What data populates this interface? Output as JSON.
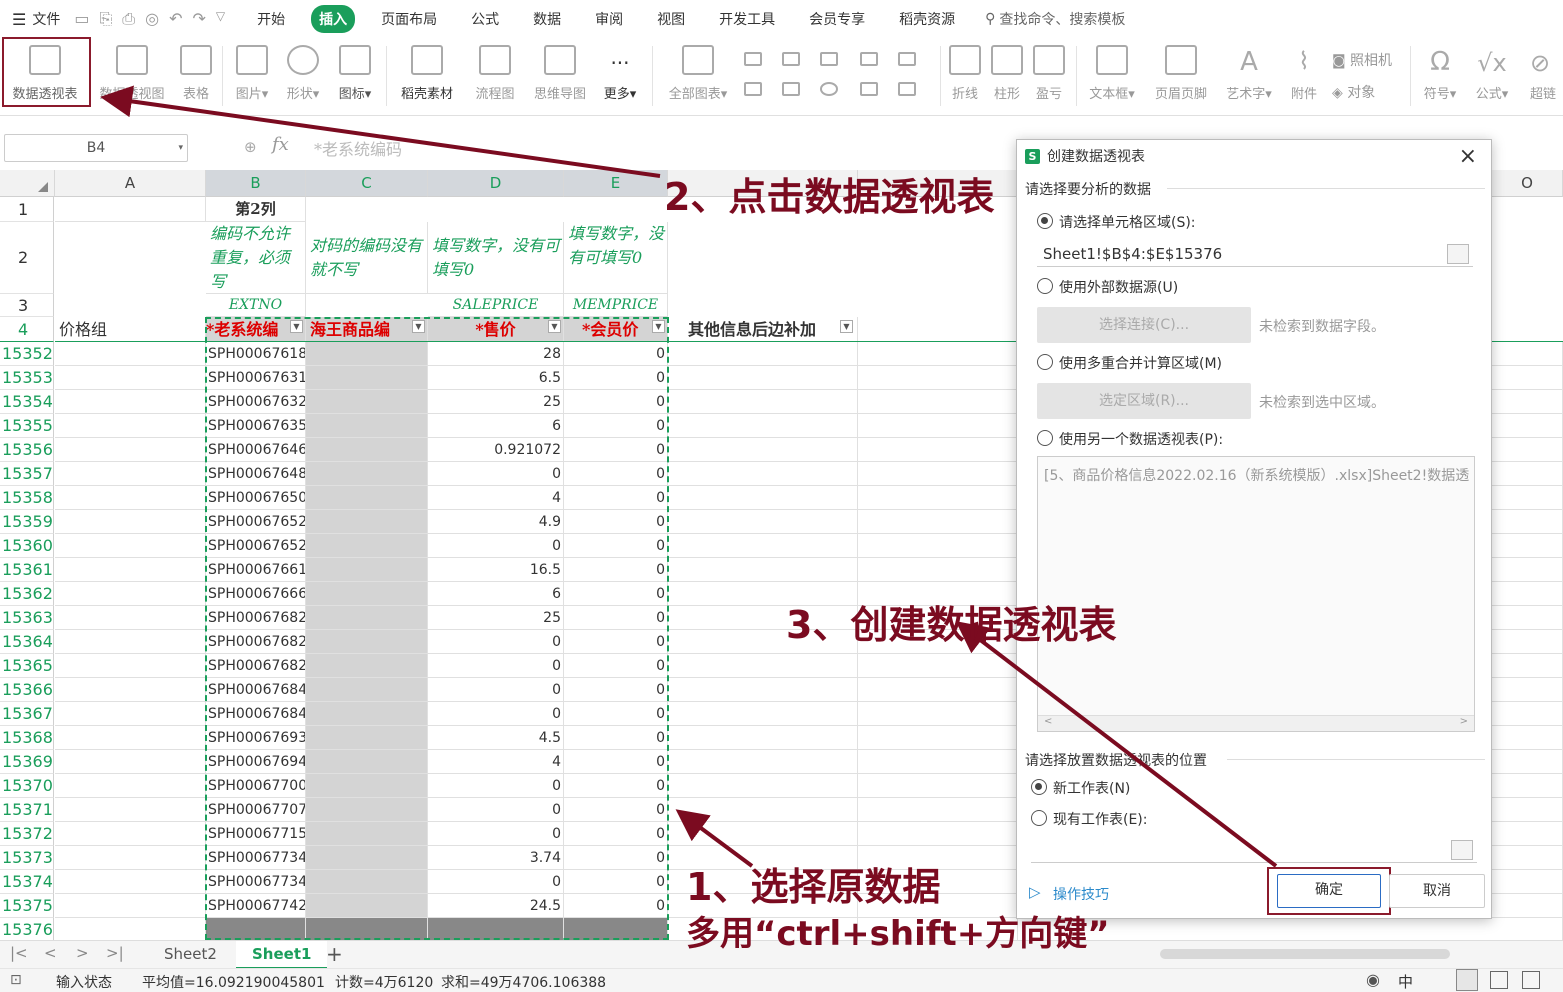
{
  "menubar": {
    "file_label": "文件",
    "items": [
      "开始",
      "插入",
      "页面布局",
      "公式",
      "数据",
      "审阅",
      "视图",
      "开发工具",
      "会员专享",
      "稻壳资源"
    ],
    "active": "插入",
    "search_label": "查找命令、搜索模板"
  },
  "ribbon": {
    "pivot_table": "数据透视表",
    "pivot_chart": "数据透视图",
    "table": "表格",
    "picture": "图片",
    "shape": "形状",
    "icon": "图标",
    "docer": "稻壳素材",
    "flowchart": "流程图",
    "mindmap": "思维导图",
    "more": "更多",
    "all_charts": "全部图表",
    "line": "折线",
    "column": "柱形",
    "winloss": "盈亏",
    "textbox": "文本框",
    "header_footer": "页眉页脚",
    "wordart": "艺术字",
    "attachment": "附件",
    "camera": "照相机",
    "object": "对象",
    "symbol": "符号",
    "formula": "公式",
    "hyperlink": "超链"
  },
  "formula_bar": {
    "name_box": "B4",
    "fx": "fx",
    "content": "*老系统编码"
  },
  "grid": {
    "columns": [
      "A",
      "B",
      "C",
      "D",
      "E",
      "O"
    ],
    "row_numbers_top": [
      "1",
      "2",
      "3",
      "4"
    ],
    "b1": "第2列",
    "b2": "编码不允许重复，必须写",
    "c2": "对码的编码没有就不写",
    "d2": "填写数字，没有可填写0",
    "e2": "填写数字，没有可填写0",
    "b3": "EXTNO",
    "d3": "SALEPRICE",
    "e3": "MEMPRICE",
    "a4": "价格组",
    "b4": "*老系统编",
    "c4": "海王商品编",
    "d4": "*售价",
    "e4": "*会员价",
    "f4": "其他信息后边补加",
    "rows": [
      {
        "n": "15352",
        "code": "SPH00067618",
        "price": "28",
        "mem": "0"
      },
      {
        "n": "15353",
        "code": "SPH00067631",
        "price": "6.5",
        "mem": "0"
      },
      {
        "n": "15354",
        "code": "SPH00067632",
        "price": "25",
        "mem": "0"
      },
      {
        "n": "15355",
        "code": "SPH00067635",
        "price": "6",
        "mem": "0"
      },
      {
        "n": "15356",
        "code": "SPH00067646",
        "price": "0.921072",
        "mem": "0"
      },
      {
        "n": "15357",
        "code": "SPH00067648",
        "price": "0",
        "mem": "0"
      },
      {
        "n": "15358",
        "code": "SPH00067650",
        "price": "4",
        "mem": "0"
      },
      {
        "n": "15359",
        "code": "SPH00067652",
        "price": "4.9",
        "mem": "0"
      },
      {
        "n": "15360",
        "code": "SPH00067652",
        "price": "0",
        "mem": "0"
      },
      {
        "n": "15361",
        "code": "SPH00067661",
        "price": "16.5",
        "mem": "0"
      },
      {
        "n": "15362",
        "code": "SPH00067666",
        "price": "6",
        "mem": "0"
      },
      {
        "n": "15363",
        "code": "SPH00067682",
        "price": "25",
        "mem": "0"
      },
      {
        "n": "15364",
        "code": "SPH00067682",
        "price": "0",
        "mem": "0"
      },
      {
        "n": "15365",
        "code": "SPH00067682",
        "price": "0",
        "mem": "0"
      },
      {
        "n": "15366",
        "code": "SPH00067684",
        "price": "0",
        "mem": "0"
      },
      {
        "n": "15367",
        "code": "SPH00067684",
        "price": "0",
        "mem": "0"
      },
      {
        "n": "15368",
        "code": "SPH00067693",
        "price": "4.5",
        "mem": "0"
      },
      {
        "n": "15369",
        "code": "SPH00067694",
        "price": "4",
        "mem": "0"
      },
      {
        "n": "15370",
        "code": "SPH00067700",
        "price": "0",
        "mem": "0"
      },
      {
        "n": "15371",
        "code": "SPH00067707",
        "price": "0",
        "mem": "0"
      },
      {
        "n": "15372",
        "code": "SPH00067715",
        "price": "0",
        "mem": "0"
      },
      {
        "n": "15373",
        "code": "SPH00067734",
        "price": "3.74",
        "mem": "0"
      },
      {
        "n": "15374",
        "code": "SPH00067734",
        "price": "0",
        "mem": "0"
      },
      {
        "n": "15375",
        "code": "SPH00067742",
        "price": "24.5",
        "mem": "0"
      },
      {
        "n": "15376",
        "code": "",
        "price": "",
        "mem": ""
      }
    ]
  },
  "sheet_tabs": {
    "tabs": [
      "Sheet2",
      "Sheet1"
    ],
    "active": "Sheet1",
    "add": "+"
  },
  "status": {
    "mode": "输入状态",
    "average": "平均值=16.092190045801",
    "count": "计数=4万6120",
    "sum": "求和=49万4706.106388",
    "ime": "中"
  },
  "dialog": {
    "title": "创建数据透视表",
    "close": "×",
    "section1": "请选择要分析的数据",
    "opt_range": "请选择单元格区域(S):",
    "range_value": "Sheet1!$B$4:$E$15376",
    "opt_external": "使用外部数据源(U)",
    "btn_connect": "选择连接(C)...",
    "note_connect": "未检索到数据字段。",
    "opt_multi": "使用多重合并计算区域(M)",
    "btn_region": "选定区域(R)...",
    "note_region": "未检索到选中区域。",
    "opt_other": "使用另一个数据透视表(P):",
    "other_item": "[5、商品价格信息2022.02.16（新系统模版）.xlsx]Sheet2!数据透",
    "section2": "请选择放置数据透视表的位置",
    "opt_new": "新工作表(N)",
    "opt_existing": "现有工作表(E):",
    "tips": "操作技巧",
    "ok": "确定",
    "cancel": "取消"
  },
  "annotations": {
    "step1": "1、选择原数据",
    "step1b": "多用“ctrl+shift+方向键”",
    "step2": "2、点击数据透视表",
    "step3": "3、创建数据透视表",
    "color": "#7b0b20"
  }
}
